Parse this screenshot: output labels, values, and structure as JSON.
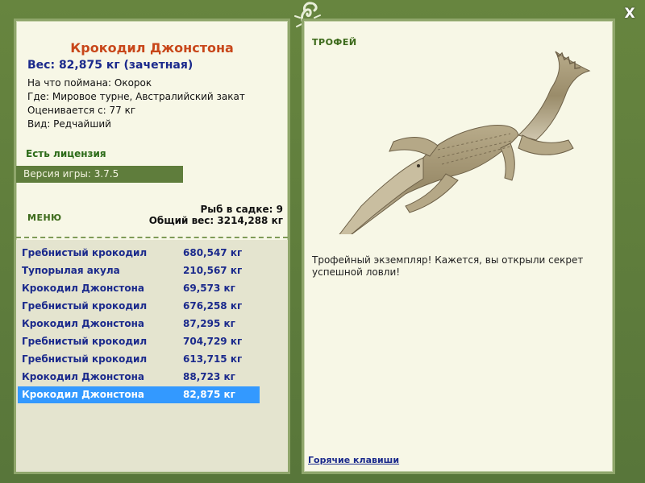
{
  "close_label": "X",
  "fish": {
    "title": "Крокодил Джонстона",
    "weight": "Вес: 82,875 кг (зачетная)",
    "info": [
      "На что поймана: Окорок",
      "Где: Мировое турне, Австралийский закат",
      "Оценивается с: 77 кг",
      "Вид: Редчайший"
    ]
  },
  "license": "Есть лицензия",
  "version": "Версия игры: 3.7.5",
  "menu_label": "МЕНЮ",
  "stats": {
    "fish_in_net": "Рыб в садке: 9",
    "total_weight": "Общий вес: 3214,288 кг"
  },
  "catches": [
    {
      "name": "Гребнистый крокодил",
      "weight": "680,547 кг"
    },
    {
      "name": "Тупорылая акула",
      "weight": "210,567 кг"
    },
    {
      "name": "Крокодил Джонстона",
      "weight": "69,573 кг"
    },
    {
      "name": "Гребнистый крокодил",
      "weight": "676,258 кг"
    },
    {
      "name": "Крокодил Джонстона",
      "weight": "87,295 кг"
    },
    {
      "name": "Гребнистый крокодил",
      "weight": "704,729 кг"
    },
    {
      "name": "Гребнистый крокодил",
      "weight": "613,715 кг"
    },
    {
      "name": "Крокодил Джонстона",
      "weight": "88,723 кг"
    },
    {
      "name": "Крокодил Джонстона",
      "weight": "82,875 кг"
    }
  ],
  "selected_index": 8,
  "trophy": {
    "label": "ТРОФЕЙ",
    "text": "Трофейный экземпляр! Кажется, вы открыли секрет успешной ловли!"
  },
  "hotkeys_label": "Горячие клавиши",
  "colors": {
    "frame": "#5f7d3c",
    "panel": "#f7f7e6",
    "title": "#c8471a",
    "value_text": "#1b2a8c",
    "selection": "#3399ff"
  }
}
